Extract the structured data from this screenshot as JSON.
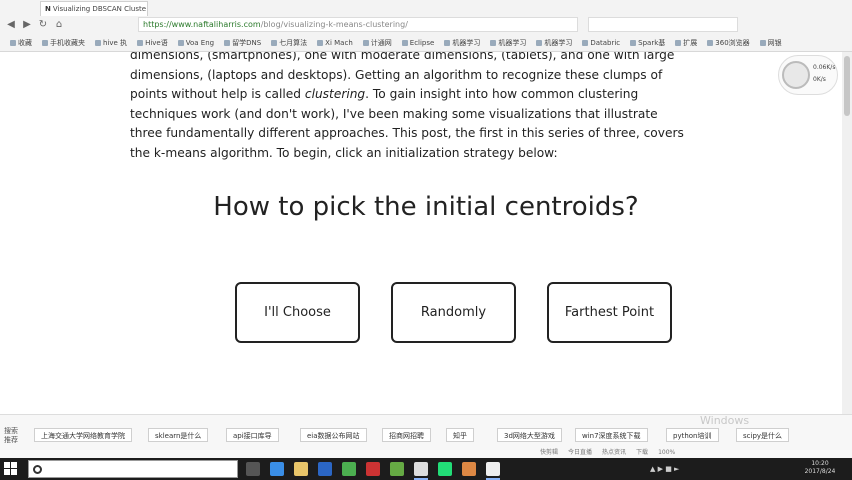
{
  "browser": {
    "tab_title": "Visualizing DBSCAN Cluste",
    "url_domain": "https://www.naftaliharris.com",
    "url_path": "/blog/visualizing-k-means-clustering/",
    "bookmarks": [
      "收藏",
      "手机收藏夹",
      "hive 执",
      "Hive语",
      "Voa Eng",
      "留学DNS",
      "七月算法",
      "Xi Mach",
      "计通网",
      "Eclipse",
      "机器学习",
      "机器学习",
      "机器学习",
      "Databric",
      "Spark基",
      "扩展",
      "360浏览器",
      "网银"
    ]
  },
  "article": {
    "line1": "dimensions, (smartphones), one with moderate dimensions, (tablets), and one with large",
    "line2": "dimensions, (laptops and desktops). Getting an algorithm to recognize these clumps of",
    "line3_pre": "points without help is called ",
    "line3_em": "clustering",
    "line3_post": ". To gain insight into how common clustering",
    "line4": "techniques work (and don't work), I've been making some visualizations that illustrate",
    "line5": "three fundamentally different approaches. This post, the first in this series of three, covers",
    "line6": "the k-means algorithm. To begin, click an initialization strategy below:"
  },
  "heading": "How to pick the initial centroids?",
  "choices": {
    "choose": "I'll Choose",
    "random": "Randomly",
    "farthest": "Farthest Point"
  },
  "speed_widget": {
    "up": "0.06K/s",
    "down": "0K/s"
  },
  "recommend": {
    "label": "搜索推荐",
    "items": [
      "上海交通大学网络教育学院",
      "sklearn是什么",
      "api接口库导",
      "eia数据公布网站",
      "招商网招聘",
      "知乎",
      "3d网络大型游戏",
      "win7深度系统下载",
      "python培训",
      "scipy是什么"
    ]
  },
  "status": [
    "快剪辑",
    "今日直播",
    "热点资讯",
    "下载",
    "100%"
  ],
  "watermark": "Windows",
  "clock": {
    "time": "10:20",
    "date": "2017/8/24"
  }
}
